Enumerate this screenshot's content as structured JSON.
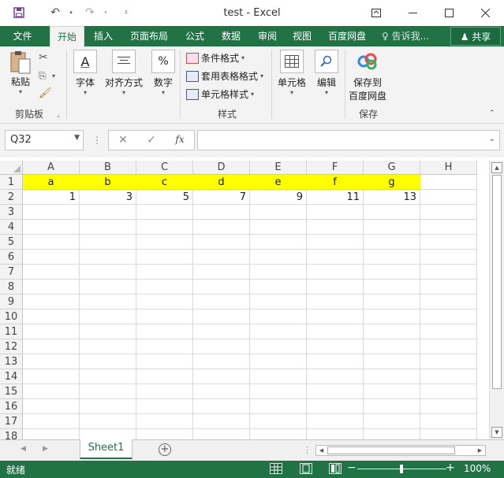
{
  "window": {
    "title": "test  -  Excel",
    "qat": {
      "save_icon": "save-icon",
      "undo_icon": "undo-icon",
      "redo_icon": "redo-icon",
      "customize_icon": "customize-icon"
    }
  },
  "tabs": [
    {
      "label": "文件"
    },
    {
      "label": "开始"
    },
    {
      "label": "插入"
    },
    {
      "label": "页面布局"
    },
    {
      "label": "公式"
    },
    {
      "label": "数据"
    },
    {
      "label": "审阅"
    },
    {
      "label": "视图"
    },
    {
      "label": "百度网盘"
    }
  ],
  "tell_me": "告诉我...",
  "share": "共享",
  "ribbon": {
    "paste": "粘贴",
    "clipboard_group": "剪贴板",
    "font": "字体",
    "alignment": "对齐方式",
    "number": "数字",
    "conditional_format": "条件格式",
    "format_as_table": "套用表格格式",
    "cell_styles": "单元格样式",
    "styles_group": "样式",
    "cells": "单元格",
    "editing": "编辑",
    "save_to": "保存到",
    "baidu_pan": "百度网盘",
    "save_group": "保存"
  },
  "formula_bar": {
    "name_box": "Q32",
    "fx": "fx",
    "formula": ""
  },
  "columns": [
    "A",
    "B",
    "C",
    "D",
    "E",
    "F",
    "G",
    "H"
  ],
  "rows": [
    "1",
    "2",
    "3",
    "4",
    "5",
    "6",
    "7",
    "8",
    "9",
    "10",
    "11",
    "12",
    "13",
    "14",
    "15",
    "16",
    "17",
    "18"
  ],
  "cells": {
    "row1": [
      "a",
      "b",
      "c",
      "d",
      "e",
      "f",
      "g"
    ],
    "row2": [
      "1",
      "3",
      "5",
      "7",
      "9",
      "11",
      "13"
    ]
  },
  "colors": {
    "accent": "#217346",
    "highlight": "#ffff00"
  },
  "sheet_tab": "Sheet1",
  "status": {
    "ready": "就绪",
    "zoom": "100%"
  }
}
